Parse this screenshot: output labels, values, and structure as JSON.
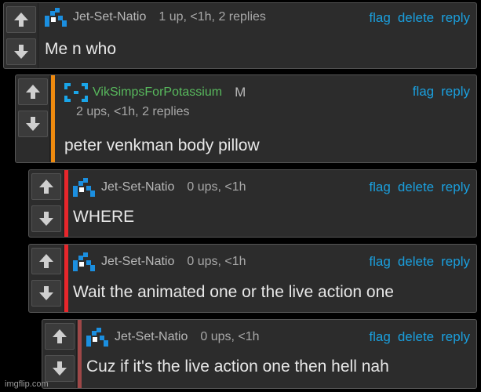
{
  "colors": {
    "accent_link": "#1aa0df",
    "bar_orange": "#ee8a0f",
    "bar_red": "#e8262b",
    "bar_dimred": "#9e4747",
    "avatar_blue": "#1b8fe0",
    "username_green": "#58b95d"
  },
  "icons": {
    "upvote": "arrow-up-icon",
    "downvote": "arrow-down-icon",
    "avatar": "pixel-avatar-icon"
  },
  "comments": [
    {
      "username": "Jet-Set-Natio",
      "stats": "1 up, <1h, 2 replies",
      "actions": [
        "flag",
        "delete",
        "reply"
      ],
      "text": "Me n who"
    },
    {
      "username": "VikSimpsForPotassium",
      "mod_badge": "M",
      "stats": "2 ups, <1h, 2 replies",
      "actions": [
        "flag",
        "reply"
      ],
      "text": "peter venkman body pillow"
    },
    {
      "username": "Jet-Set-Natio",
      "stats": "0 ups, <1h",
      "actions": [
        "flag",
        "delete",
        "reply"
      ],
      "text": "WHERE"
    },
    {
      "username": "Jet-Set-Natio",
      "stats": "0 ups, <1h",
      "actions": [
        "flag",
        "delete",
        "reply"
      ],
      "text": "Wait the animated one or the live action one"
    },
    {
      "username": "Jet-Set-Natio",
      "stats": "0 ups, <1h",
      "actions": [
        "flag",
        "delete",
        "reply"
      ],
      "text": "Cuz if it's the live action one then hell nah"
    }
  ],
  "watermark": "imgflip.com"
}
